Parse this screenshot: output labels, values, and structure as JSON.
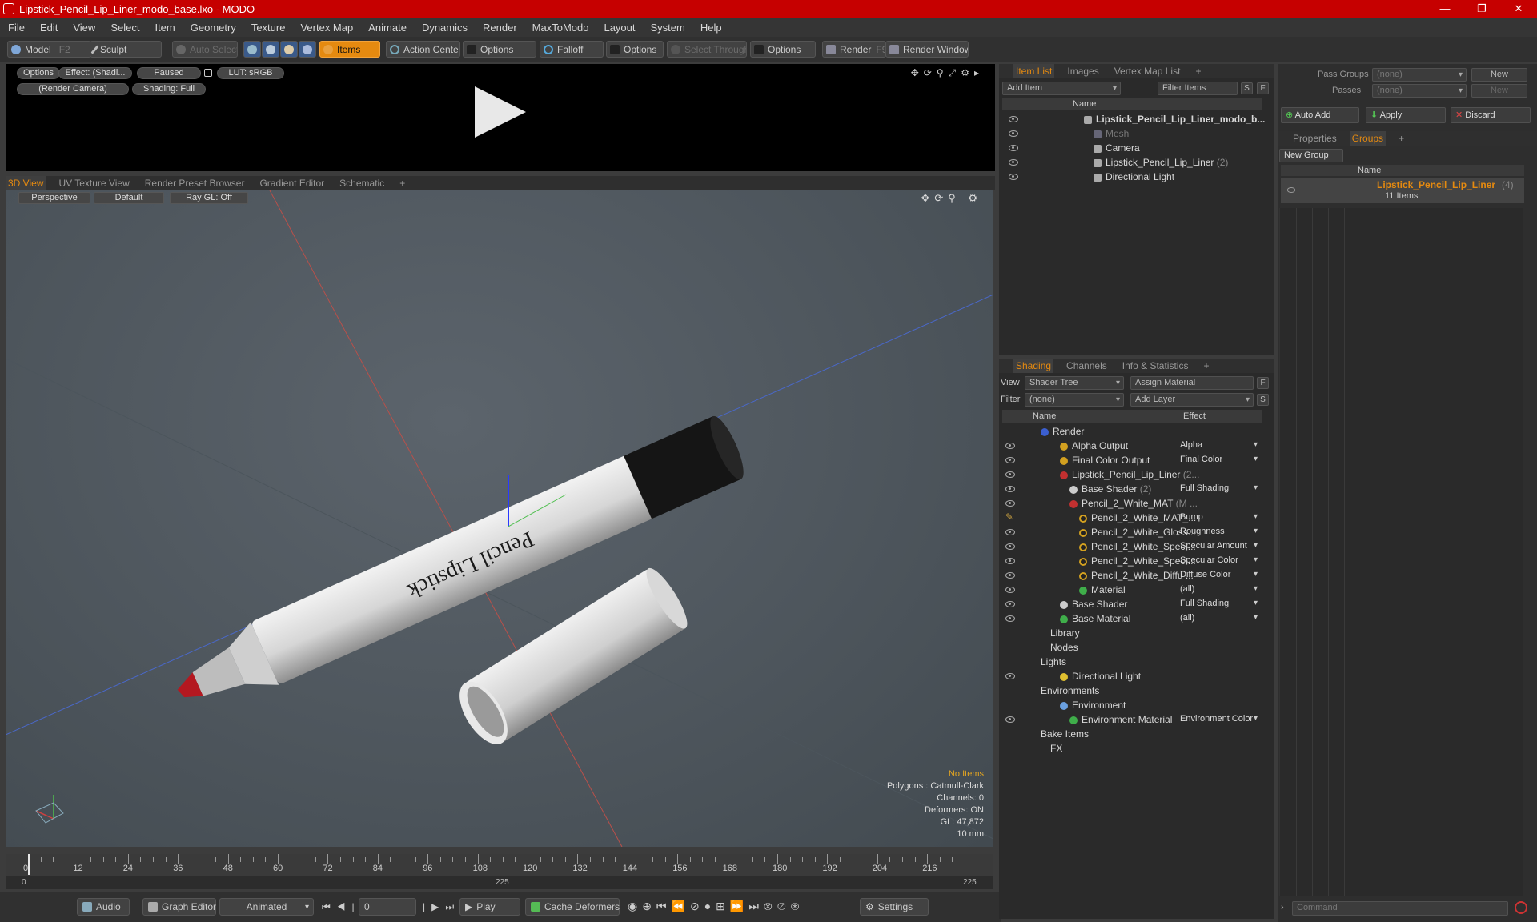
{
  "window": {
    "title": "Lipstick_Pencil_Lip_Liner_modo_base.lxo - MODO",
    "minimize": "—",
    "maximize": "❐",
    "close": "✕"
  },
  "menu": [
    "File",
    "Edit",
    "View",
    "Select",
    "Item",
    "Geometry",
    "Texture",
    "Vertex Map",
    "Animate",
    "Dynamics",
    "Render",
    "MaxToModo",
    "Layout",
    "System",
    "Help"
  ],
  "toolbar": {
    "model": "Model",
    "model_key": "F2",
    "sculpt": "Sculpt",
    "auto_select": "Auto Select",
    "items": "Items",
    "action_center": "Action Center",
    "options1": "Options",
    "falloff": "Falloff",
    "options2": "Options",
    "select_through": "Select Through",
    "options3": "Options",
    "render": "Render",
    "render_key": "F9",
    "render_window": "Render Window"
  },
  "preview": {
    "options": "Options",
    "effect": "Effect: (Shadi...",
    "paused": "Paused",
    "lut": "LUT: sRGB",
    "camera": "(Render Camera)",
    "shading": "Shading: Full"
  },
  "viewport_tabs": {
    "tabs": [
      "3D View",
      "UV Texture View",
      "Render Preset Browser",
      "Gradient Editor",
      "Schematic"
    ],
    "active": "3D View",
    "add": "+"
  },
  "viewport": {
    "perspective": "Perspective",
    "default": "Default",
    "raygl": "Ray GL: Off",
    "label_text": "Pencil Lipstick",
    "info": {
      "no_items": "No Items",
      "polygons": "Polygons : Catmull-Clark",
      "channels": "Channels: 0",
      "deformers": "Deformers: ON",
      "gl": "GL: 47,872",
      "scale": "10 mm"
    },
    "colors": {
      "tip": "#c0181e",
      "body": "#d8d8d8",
      "cap": "#151515"
    }
  },
  "timeline": {
    "ticks": [
      "0",
      "12",
      "24",
      "36",
      "48",
      "60",
      "72",
      "84",
      "96",
      "108",
      "120",
      "132",
      "144",
      "156",
      "168",
      "180",
      "192",
      "204",
      "216"
    ],
    "start": "0",
    "mid": "225",
    "end": "225"
  },
  "bottombar": {
    "audio": "Audio",
    "graph_editor": "Graph Editor",
    "animated": "Animated",
    "frame": "0",
    "play": "Play",
    "cache_deformers": "Cache Deformers",
    "settings": "Settings"
  },
  "item_list": {
    "tabs": [
      "Item List",
      "Images",
      "Vertex Map List"
    ],
    "active": "Item List",
    "add": "+",
    "add_item": "Add Item",
    "filter_items": "Filter Items",
    "s": "S",
    "f": "F",
    "col_name": "Name",
    "rows": [
      {
        "label": "Lipstick_Pencil_Lip_Liner_modo_b...",
        "count": "",
        "indent": 0,
        "bold": true
      },
      {
        "label": "Mesh",
        "count": "",
        "indent": 1,
        "dim": true
      },
      {
        "label": "Camera",
        "count": "",
        "indent": 1
      },
      {
        "label": "Lipstick_Pencil_Lip_Liner",
        "count": "(2)",
        "indent": 1
      },
      {
        "label": "Directional Light",
        "count": "",
        "indent": 1
      }
    ]
  },
  "shading": {
    "tabs": [
      "Shading",
      "Channels",
      "Info & Statistics"
    ],
    "active": "Shading",
    "add": "+",
    "view_label": "View",
    "view_value": "Shader Tree",
    "assign_material": "Assign Material",
    "filter_label": "Filter",
    "filter_value": "(none)",
    "add_layer": "Add Layer",
    "f": "F",
    "s": "S",
    "col_name": "Name",
    "col_effect": "Effect",
    "rows": [
      {
        "label": "Render",
        "effect": "",
        "indent": 0,
        "eye": false,
        "color": "#3b5fd0"
      },
      {
        "label": "Alpha Output",
        "effect": "Alpha",
        "indent": 2,
        "eye": true,
        "color": "#d2a020"
      },
      {
        "label": "Final Color Output",
        "effect": "Final Color",
        "indent": 2,
        "eye": true,
        "color": "#d2a020"
      },
      {
        "label": "Lipstick_Pencil_Lip_Liner",
        "suffix": "(2...",
        "effect": "",
        "indent": 2,
        "eye": true,
        "color": "#c23030"
      },
      {
        "label": "Base Shader",
        "suffix": "(2)",
        "effect": "Full Shading",
        "indent": 3,
        "eye": true,
        "color": "#cccccc"
      },
      {
        "label": "Pencil_2_White_MAT",
        "suffix": "(M ...",
        "effect": "",
        "indent": 3,
        "eye": true,
        "color": "#c23030"
      },
      {
        "label": "Pencil_2_White_MAT_...",
        "effect": "Bump",
        "indent": 4,
        "eye": false,
        "brush": true,
        "color": "#222222"
      },
      {
        "label": "Pencil_2_White_Gloss...",
        "effect": "Roughness",
        "indent": 4,
        "eye": true,
        "color": "#222222"
      },
      {
        "label": "Pencil_2_White_Spec ...",
        "effect": "Specular Amount",
        "indent": 4,
        "eye": true,
        "color": "#222222"
      },
      {
        "label": "Pencil_2_White_Spec ...",
        "effect": "Specular Color",
        "indent": 4,
        "eye": true,
        "color": "#222222"
      },
      {
        "label": "Pencil_2_White_Diffu ...",
        "effect": "Diffuse Color",
        "indent": 4,
        "eye": true,
        "color": "#222222"
      },
      {
        "label": "Material",
        "effect": "(all)",
        "indent": 4,
        "eye": true,
        "color": "#3fae4a"
      },
      {
        "label": "Base Shader",
        "effect": "Full Shading",
        "indent": 2,
        "eye": true,
        "color": "#cccccc"
      },
      {
        "label": "Base Material",
        "effect": "(all)",
        "indent": 2,
        "eye": true,
        "color": "#3fae4a"
      },
      {
        "label": "Library",
        "effect": "",
        "indent": 1,
        "eye": false,
        "color": ""
      },
      {
        "label": "Nodes",
        "effect": "",
        "indent": 1,
        "eye": false,
        "color": ""
      },
      {
        "label": "Lights",
        "effect": "",
        "indent": 0,
        "eye": false,
        "color": ""
      },
      {
        "label": "Directional Light",
        "effect": "",
        "indent": 2,
        "eye": true,
        "color": "#e0c030"
      },
      {
        "label": "Environments",
        "effect": "",
        "indent": 0,
        "eye": false,
        "color": ""
      },
      {
        "label": "Environment",
        "effect": "",
        "indent": 2,
        "eye": false,
        "color": "#6aa0e0"
      },
      {
        "label": "Environment Material",
        "effect": "Environment Color",
        "indent": 3,
        "eye": true,
        "color": "#3fae4a"
      },
      {
        "label": "Bake Items",
        "effect": "",
        "indent": 0,
        "eye": false,
        "color": ""
      },
      {
        "label": "FX",
        "effect": "",
        "indent": 1,
        "eye": false,
        "color": ""
      }
    ]
  },
  "groups": {
    "pass_groups_label": "Pass Groups",
    "pass_groups_value": "(none)",
    "new": "New",
    "passes_label": "Passes",
    "passes_value": "(none)",
    "new2": "New",
    "auto_add": "Auto Add",
    "apply": "Apply",
    "discard": "Discard",
    "tabs": [
      "Properties",
      "Groups"
    ],
    "active": "Groups",
    "add": "+",
    "new_group": "New Group",
    "col_name": "Name",
    "item_name": "Lipstick_Pencil_Lip_Liner",
    "item_count": "(4)",
    "item_sub": "11 Items",
    "command_placeholder": "Command"
  }
}
